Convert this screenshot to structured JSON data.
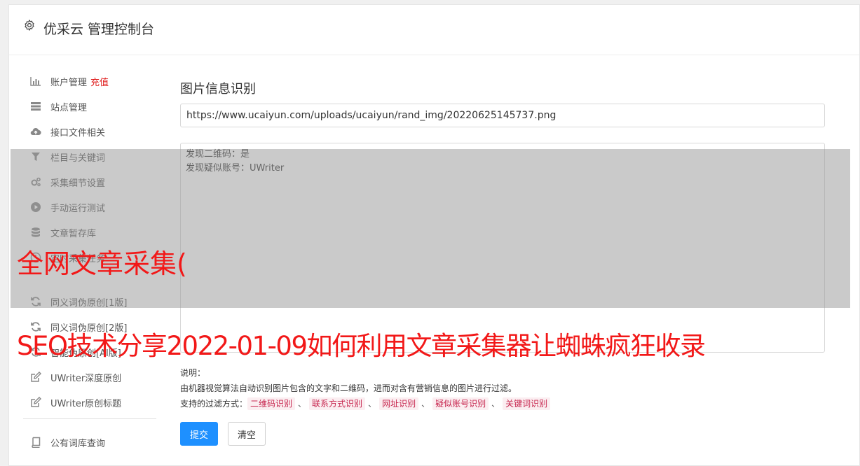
{
  "header": {
    "title": "优采云 管理控制台",
    "icon": "gear-icon"
  },
  "sidebar": {
    "items": [
      {
        "label": "账户管理",
        "badge": "充值",
        "icon": "bar-chart-icon"
      },
      {
        "label": "站点管理",
        "icon": "server-icon"
      },
      {
        "label": "接口文件相关",
        "icon": "cloud-upload-icon"
      },
      {
        "label": "栏目与关键词",
        "icon": "filter-icon"
      },
      {
        "label": "采集细节设置",
        "icon": "gears-icon"
      },
      {
        "label": "手动运行测试",
        "icon": "play-circle-icon"
      },
      {
        "label": "文章暂存库",
        "icon": "database-icon"
      },
      {
        "label": "定时采集任务",
        "icon": "clock-icon"
      },
      {
        "label": "同义词伪原创[1版]",
        "icon": "refresh-icon"
      },
      {
        "label": "同义词伪原创[2版]",
        "icon": "refresh-icon"
      },
      {
        "label": "智能伪原创[AI版]",
        "icon": "refresh-icon"
      },
      {
        "label": "UWriter深度原创",
        "icon": "edit-icon"
      },
      {
        "label": "UWriter原创标题",
        "icon": "edit-icon"
      },
      {
        "label": "公有词库查询",
        "icon": "book-icon"
      }
    ]
  },
  "main": {
    "section_title": "图片信息识别",
    "url_value": "https://www.ucaiyun.com/uploads/ucaiyun/rand_img/20220625145737.png",
    "result_lines": [
      "发现二维码：是",
      "发现疑似账号：UWriter"
    ],
    "notes_label": "说明：",
    "notes_text": "由机器视觉算法自动识别图片包含的文字和二维码，进而对含有营销信息的图片进行过滤。",
    "filters_label": "支持的过滤方式：",
    "filters": [
      "二维码识别",
      "联系方式识别",
      "网址识别",
      "疑似账号识别",
      "关键词识别"
    ],
    "filter_separator": "、",
    "submit_label": "提交",
    "clear_label": "清空"
  },
  "overlay": {
    "line1": "全网文章采集(",
    "line2": "SEO技术分享2022-01-09如何利用文章采集器让蜘蛛疯狂收录"
  },
  "colors": {
    "accent": "#1e90ff",
    "badge": "#e02020",
    "overlay_text": "#f21818",
    "tag_text": "#c7254e"
  }
}
